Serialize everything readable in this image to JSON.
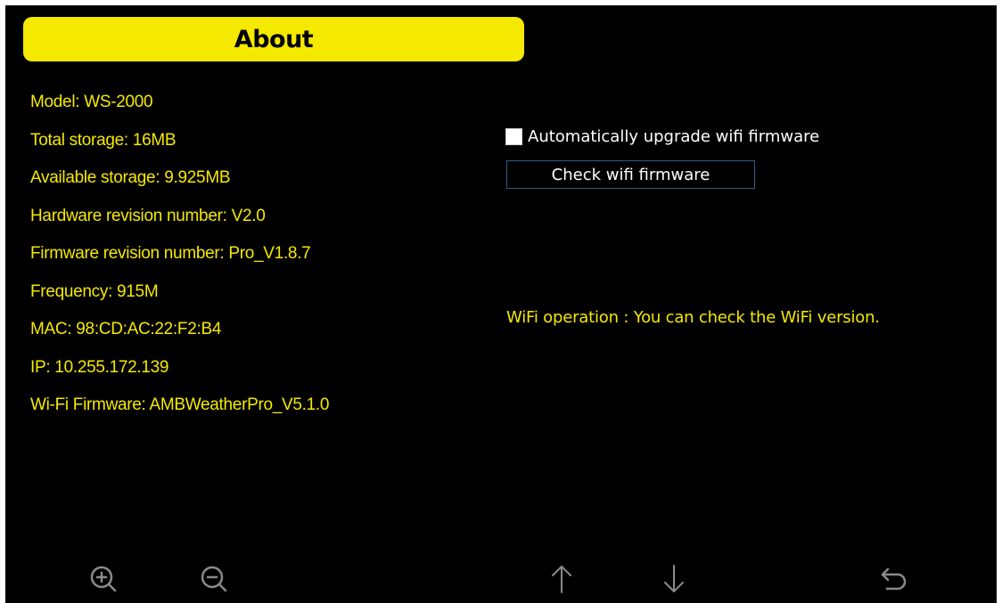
{
  "header": {
    "title": "About"
  },
  "info": {
    "items": [
      "Model: WS-2000",
      "Total storage: 16MB",
      "Available storage: 9.925MB",
      "Hardware revision number: V2.0",
      "Firmware revision number: Pro_V1.8.7",
      "Frequency: 915M",
      "MAC: 98:CD:AC:22:F2:B4",
      "IP: 10.255.172.139",
      "Wi-Fi Firmware: AMBWeatherPro_V5.1.0"
    ]
  },
  "wifi": {
    "auto_upgrade_label": "Automatically upgrade wifi firmware",
    "auto_upgrade_checked": false,
    "check_button_label": "Check wifi firmware",
    "operation_note": "WiFi operation : You can check the WiFi version."
  },
  "toolbar": {
    "icons": [
      "zoom-in-icon",
      "zoom-out-icon",
      "arrow-up-icon",
      "arrow-down-icon",
      "back-icon"
    ]
  },
  "colors": {
    "background": "#000000",
    "accent_yellow": "#f5e900",
    "text_white": "#ffffff",
    "button_border": "#2f5d8a",
    "icon_gray": "#8a8a8a"
  }
}
